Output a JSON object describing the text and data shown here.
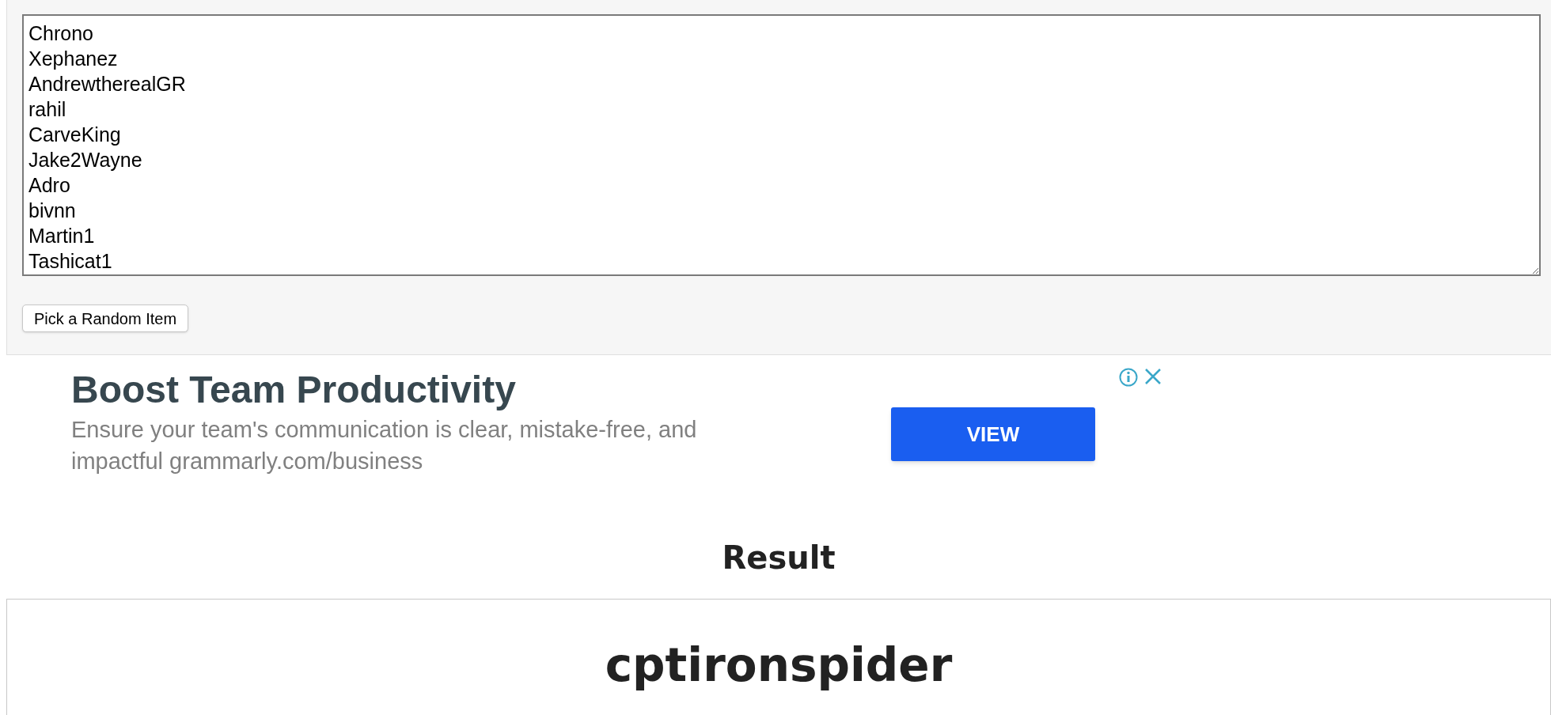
{
  "items_field": {
    "lines": [
      "Chrono",
      "Xephanez",
      "AndrewtherealGR",
      "rahil",
      "CarveKing",
      "Jake2Wayne",
      "Adro",
      "bivnn",
      "Martin1",
      "Tashicat1"
    ]
  },
  "pick_button": "Pick a Random Item",
  "ad": {
    "title": "Boost Team Productivity",
    "body": "Ensure your team's communication is clear, mistake-free, and impactful grammarly.com/business",
    "button": "VIEW"
  },
  "result": {
    "heading": "Result",
    "value": "cptironspider"
  }
}
